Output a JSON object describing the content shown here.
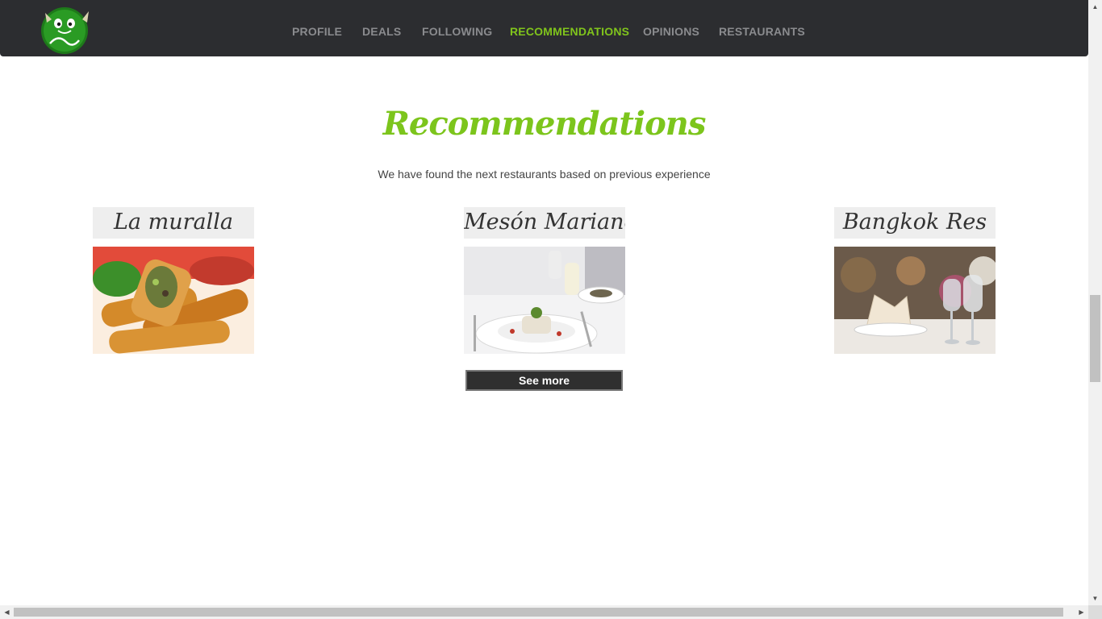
{
  "nav": {
    "logo": "Foogy monster logo",
    "items": [
      {
        "label": "PROFILE",
        "active": false
      },
      {
        "label": "DEALS",
        "active": false
      },
      {
        "label": "FOLLOWING",
        "active": false
      },
      {
        "label": "RECOMMENDATIONS",
        "active": true
      },
      {
        "label": "OPINIONS",
        "active": false
      },
      {
        "label": "RESTAURANTS",
        "active": false
      }
    ]
  },
  "main": {
    "title": "Recommendations",
    "subtitle": "We have found the next restaurants based on previous experience",
    "cards": [
      {
        "name": "La muralla",
        "image": "spring rolls"
      },
      {
        "name": "Mesón Mariano",
        "image": "plated dish with wine glasses"
      },
      {
        "name": "Bangkok Res",
        "image": "restaurant table setting"
      }
    ],
    "see_more_label": "See more"
  },
  "colors": {
    "navbar": "#2c2d30",
    "nav_text": "#8a8b8e",
    "accent": "#80c41c",
    "button": "#2f2f2f"
  }
}
